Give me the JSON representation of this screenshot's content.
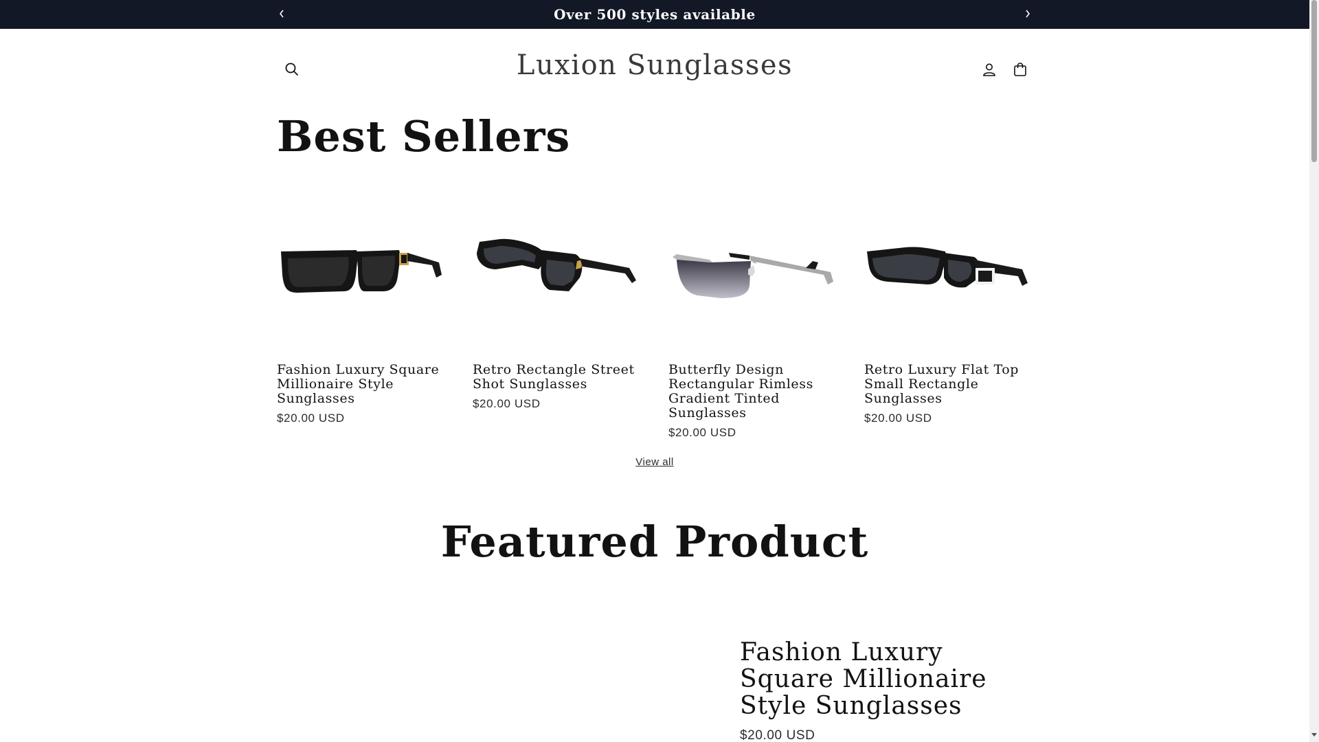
{
  "announcement": {
    "text": "Over 500 styles available",
    "prev_icon": "chevron-left-icon",
    "next_icon": "chevron-right-icon"
  },
  "header": {
    "logo": "Luxion Sunglasses",
    "icons": [
      "search-icon",
      "account-icon",
      "cart-icon"
    ]
  },
  "best_sellers": {
    "title": "Best Sellers",
    "products": [
      {
        "title": "Fashion Luxury Square Millionaire Style Sunglasses",
        "price": "$20.00 USD"
      },
      {
        "title": "Retro Rectangle Street Shot Sunglasses",
        "price": "$20.00 USD"
      },
      {
        "title": "Butterfly Design Rectangular Rimless Gradient Tinted Sunglasses",
        "price": "$20.00 USD"
      },
      {
        "title": "Retro Luxury Flat Top Small Rectangle Sunglasses",
        "price": "$20.00 USD"
      }
    ],
    "view_all": "View all"
  },
  "featured": {
    "title": "Featured Product",
    "product_name": "Fashion Luxury Square Millionaire Style Sunglasses",
    "price": "$20.00 USD"
  },
  "colors": {
    "announcement_bg": "#121826",
    "text": "#121212"
  }
}
